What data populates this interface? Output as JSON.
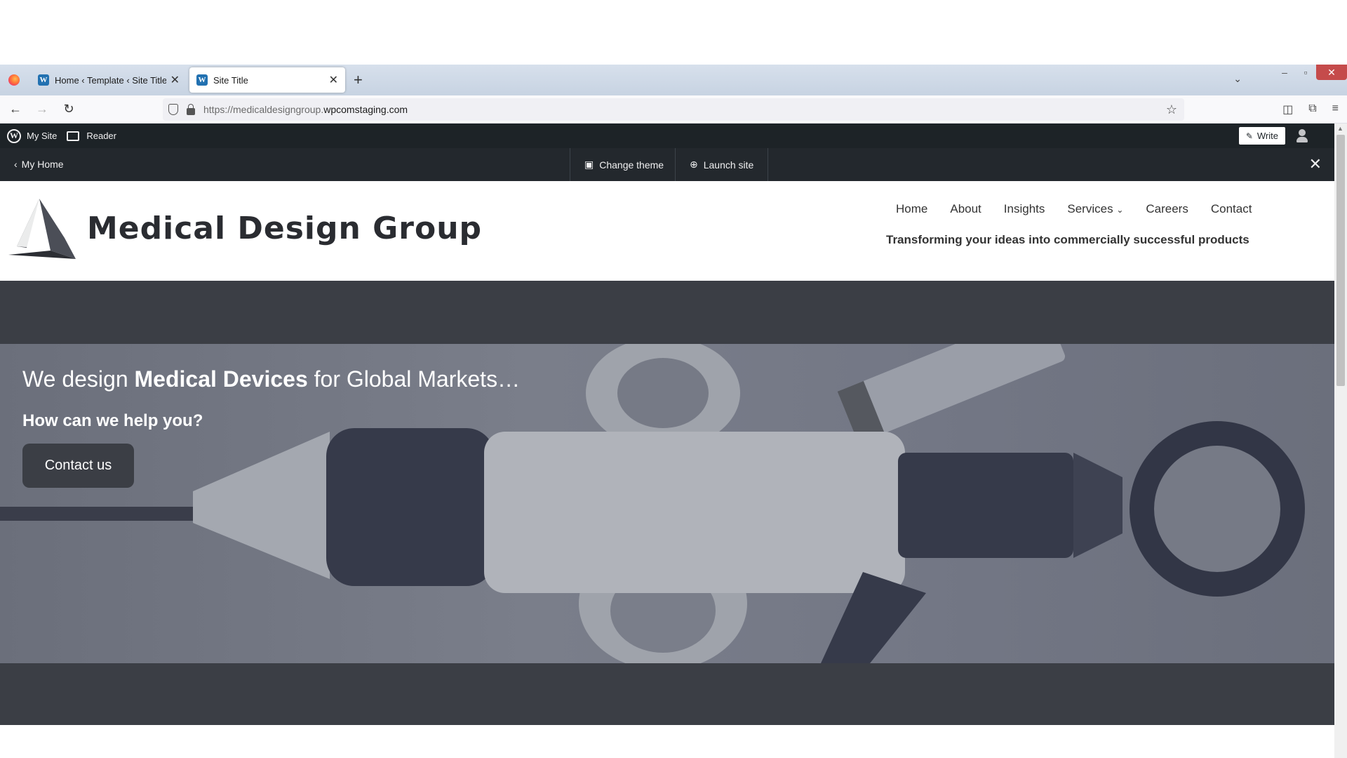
{
  "browser": {
    "tabs": [
      {
        "title": "Home ‹ Template ‹ Site Title ‹ E",
        "active": false
      },
      {
        "title": "Site Title",
        "active": true
      }
    ],
    "new_tab": "+",
    "url_host_prefix": "https://medicaldesigngroup.",
    "url_host_main": "wpcomstaging.com",
    "icons": [
      "back-icon",
      "forward-icon",
      "reload-icon",
      "shield-icon",
      "lock-icon",
      "star-icon",
      "pocket-icon",
      "extensions-icon",
      "menu-icon"
    ]
  },
  "wp_admin_bar": {
    "my_site": "My Site",
    "reader": "Reader",
    "write": "Write"
  },
  "launch_bar": {
    "my_home": "My Home",
    "change_theme": "Change theme",
    "launch_site": "Launch site"
  },
  "site": {
    "title": "Medical Design Group",
    "nav": [
      "Home",
      "About",
      "Insights",
      "Services",
      "Careers",
      "Contact"
    ],
    "tagline": "Transforming your ideas into commercially successful products"
  },
  "hero": {
    "heading_pre": "We design ",
    "heading_strong": "Medical Devices",
    "heading_post": " for Global Markets…",
    "subheading": "How can we help you?",
    "button": "Contact us"
  },
  "colors": {
    "wp_admin_bg": "#1d2327",
    "launch_bar_bg": "#23282d",
    "hero_band": "#3b3e45",
    "hero_overlay": "#737785",
    "button_bg": "#3b3e45"
  }
}
